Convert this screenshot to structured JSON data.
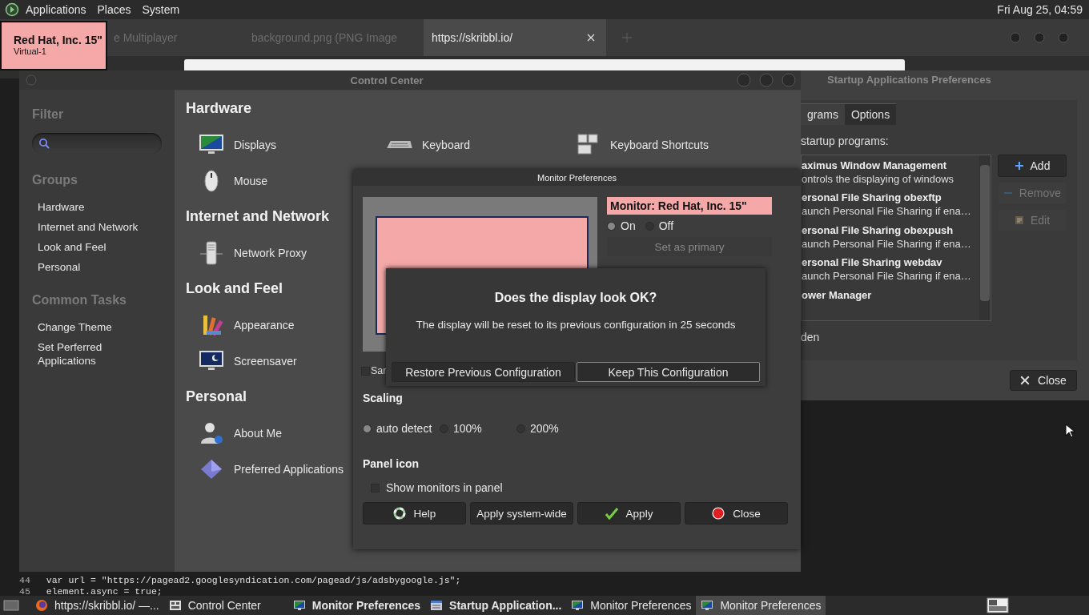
{
  "top_panel": {
    "menus": [
      "Applications",
      "Places",
      "System"
    ],
    "clock": "Fri Aug 25, 04:59"
  },
  "osd": {
    "title": "Red Hat, Inc. 15\"",
    "subtitle": "Virtual-1"
  },
  "browser": {
    "tabs": [
      {
        "label": "e Multiplayer",
        "selected": false
      },
      {
        "label": "background.png (PNG Image",
        "selected": false
      },
      {
        "label": "https://skribbl.io/",
        "selected": true
      }
    ],
    "code_lines": [
      {
        "number": "44",
        "text": "var url = \"https://pagead2.googlesyndication.com/pagead/js/adsbygoogle.js\";"
      },
      {
        "number": "45",
        "text": "element.async = true;"
      }
    ]
  },
  "control_center": {
    "title": "Control Center",
    "filter_label": "Filter",
    "groups_label": "Groups",
    "groups": [
      "Hardware",
      "Internet and Network",
      "Look and Feel",
      "Personal"
    ],
    "tasks_label": "Common Tasks",
    "tasks": [
      "Change Theme",
      "Set Perferred Applications"
    ],
    "sections": [
      {
        "title": "Hardware",
        "rows": [
          [
            {
              "label": "Displays",
              "kind": "display"
            },
            {
              "label": "Keyboard",
              "kind": "keyboard"
            },
            {
              "label": "Keyboard Shortcuts",
              "kind": "shortcuts"
            }
          ],
          [
            {
              "label": "Mouse",
              "kind": "mouse"
            }
          ]
        ]
      },
      {
        "title": "Internet and Network",
        "rows": [
          [
            {
              "label": "Network Proxy",
              "kind": "proxy"
            }
          ]
        ]
      },
      {
        "title": "Look and Feel",
        "rows": [
          [
            {
              "label": "Appearance",
              "kind": "appearance"
            }
          ],
          [
            {
              "label": "Screensaver",
              "kind": "screensaver"
            }
          ]
        ]
      },
      {
        "title": "Personal",
        "rows": [
          [
            {
              "label": "About Me",
              "kind": "person"
            }
          ],
          [
            {
              "label": "Preferred Applications",
              "kind": "preferred"
            }
          ]
        ]
      }
    ]
  },
  "startup": {
    "title": "Startup Applications Preferences",
    "tabs": [
      {
        "label": "grams",
        "selected": true
      },
      {
        "label": "Options",
        "selected": false
      }
    ],
    "list_label": "startup programs:",
    "programs": [
      {
        "name": "aximus Window Management",
        "description": "ontrols the displaying of windows"
      },
      {
        "name": "ersonal File Sharing obexftp",
        "description": "aunch Personal File Sharing if ena…"
      },
      {
        "name": "ersonal File Sharing obexpush",
        "description": "aunch Personal File Sharing if ena…"
      },
      {
        "name": "ersonal File Sharing webdav",
        "description": "aunch Personal File Sharing if ena…"
      },
      {
        "name": "ower Manager"
      }
    ],
    "buttons": [
      {
        "label": "Add",
        "kind": "add",
        "disabled": false
      },
      {
        "label": "Remove",
        "kind": "remove",
        "disabled": true
      },
      {
        "label": "Edit",
        "kind": "edit",
        "disabled": true
      }
    ],
    "hidden_label": "den",
    "close": "Close"
  },
  "monitor": {
    "title": "Monitor Preferences",
    "monitor_label": "Monitor: Red Hat, Inc. 15\"",
    "power": [
      {
        "label": "On",
        "selected": true
      },
      {
        "label": "Off",
        "selected": false
      }
    ],
    "primary_button": {
      "label": "Set as primary",
      "disabled": true
    },
    "same_image": {
      "label": "Sar",
      "checked": false
    },
    "scaling_label": "Scaling",
    "scaling": [
      {
        "label": "auto detect",
        "selected": true
      },
      {
        "label": "100%",
        "selected": false
      },
      {
        "label": "200%",
        "selected": false
      }
    ],
    "panel_label": "Panel icon",
    "show_in_panel": {
      "label": "Show monitors in panel",
      "checked": false
    },
    "buttons": [
      {
        "label": "Help",
        "kind": "help"
      },
      {
        "label": "Apply system-wide",
        "kind": "plain"
      },
      {
        "label": "Apply",
        "kind": "apply"
      },
      {
        "label": "Close",
        "kind": "close"
      }
    ]
  },
  "dialog": {
    "title": "Does the display look OK?",
    "message": "The display will be reset to its previous configuration in 25 seconds",
    "buttons": [
      {
        "label": "Restore Previous Configuration",
        "default": false
      },
      {
        "label": "Keep This Configuration",
        "default": true
      }
    ]
  },
  "taskbar": {
    "items": [
      {
        "label": "https://skribbl.io/ —...",
        "kind": "browser",
        "urgent": false,
        "selected": false
      },
      {
        "label": "Control Center",
        "kind": "control",
        "urgent": false,
        "selected": false
      },
      {
        "label": "Monitor Preferences",
        "kind": "monitor",
        "urgent": true,
        "selected": false
      },
      {
        "label": "Startup Application...",
        "kind": "startup",
        "urgent": true,
        "selected": false
      },
      {
        "label": "Monitor Preferences",
        "kind": "monitor",
        "urgent": false,
        "selected": false
      },
      {
        "label": "Monitor Preferences",
        "kind": "monitor",
        "urgent": false,
        "selected": true
      }
    ]
  }
}
